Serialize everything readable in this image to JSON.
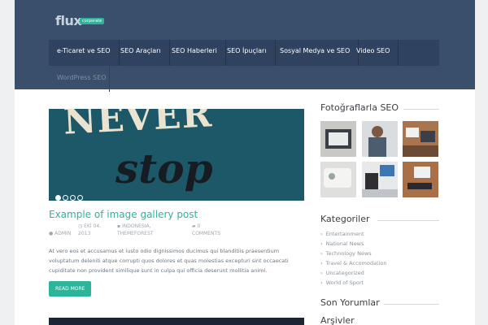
{
  "brand": {
    "name": "flux",
    "badge": "corporate"
  },
  "nav": {
    "items": [
      "e-Ticaret ve SEO",
      "SEO Araçları",
      "SEO Haberleri",
      "SEO İpuçları",
      "Sosyal Medya ve SEO",
      "Video SEO"
    ],
    "second_row": "WordPress SEO"
  },
  "slider": {
    "line1": "NEVER",
    "line2": "stop",
    "slides": 4,
    "active_slide": 1
  },
  "post": {
    "title": "Example of image gallery post",
    "date": "EKİ 04, 2013",
    "author": "ADMIN",
    "categories": "INDONESIA, THEMEFOREST",
    "comments_count": "0",
    "comments_label": "COMMENTS",
    "excerpt": "At vero eos et accusamus et iusto odio dignissimos ducimus qui blanditiis praesentium voluptatum deleniti atque corrupti quos dolores et quas molestias excepturi sint occaecati cupiditate non provident similique sunt in culpa qui officia deserunt mollitia animi.",
    "read_more": "READ MORE"
  },
  "sidebar": {
    "photos_title": "Fotoğraflarla SEO",
    "categories_title": "Kategoriler",
    "categories": [
      "Entertainment",
      "National News",
      "Technology News",
      "Travel & Accomodation",
      "Uncategorized",
      "World of Sport"
    ],
    "comments_title": "Son Yorumlar",
    "archives_title": "Arşivler"
  },
  "colors": {
    "header": "#3a4f6b",
    "accent": "#2bb59a",
    "nav": "#2f4360"
  }
}
